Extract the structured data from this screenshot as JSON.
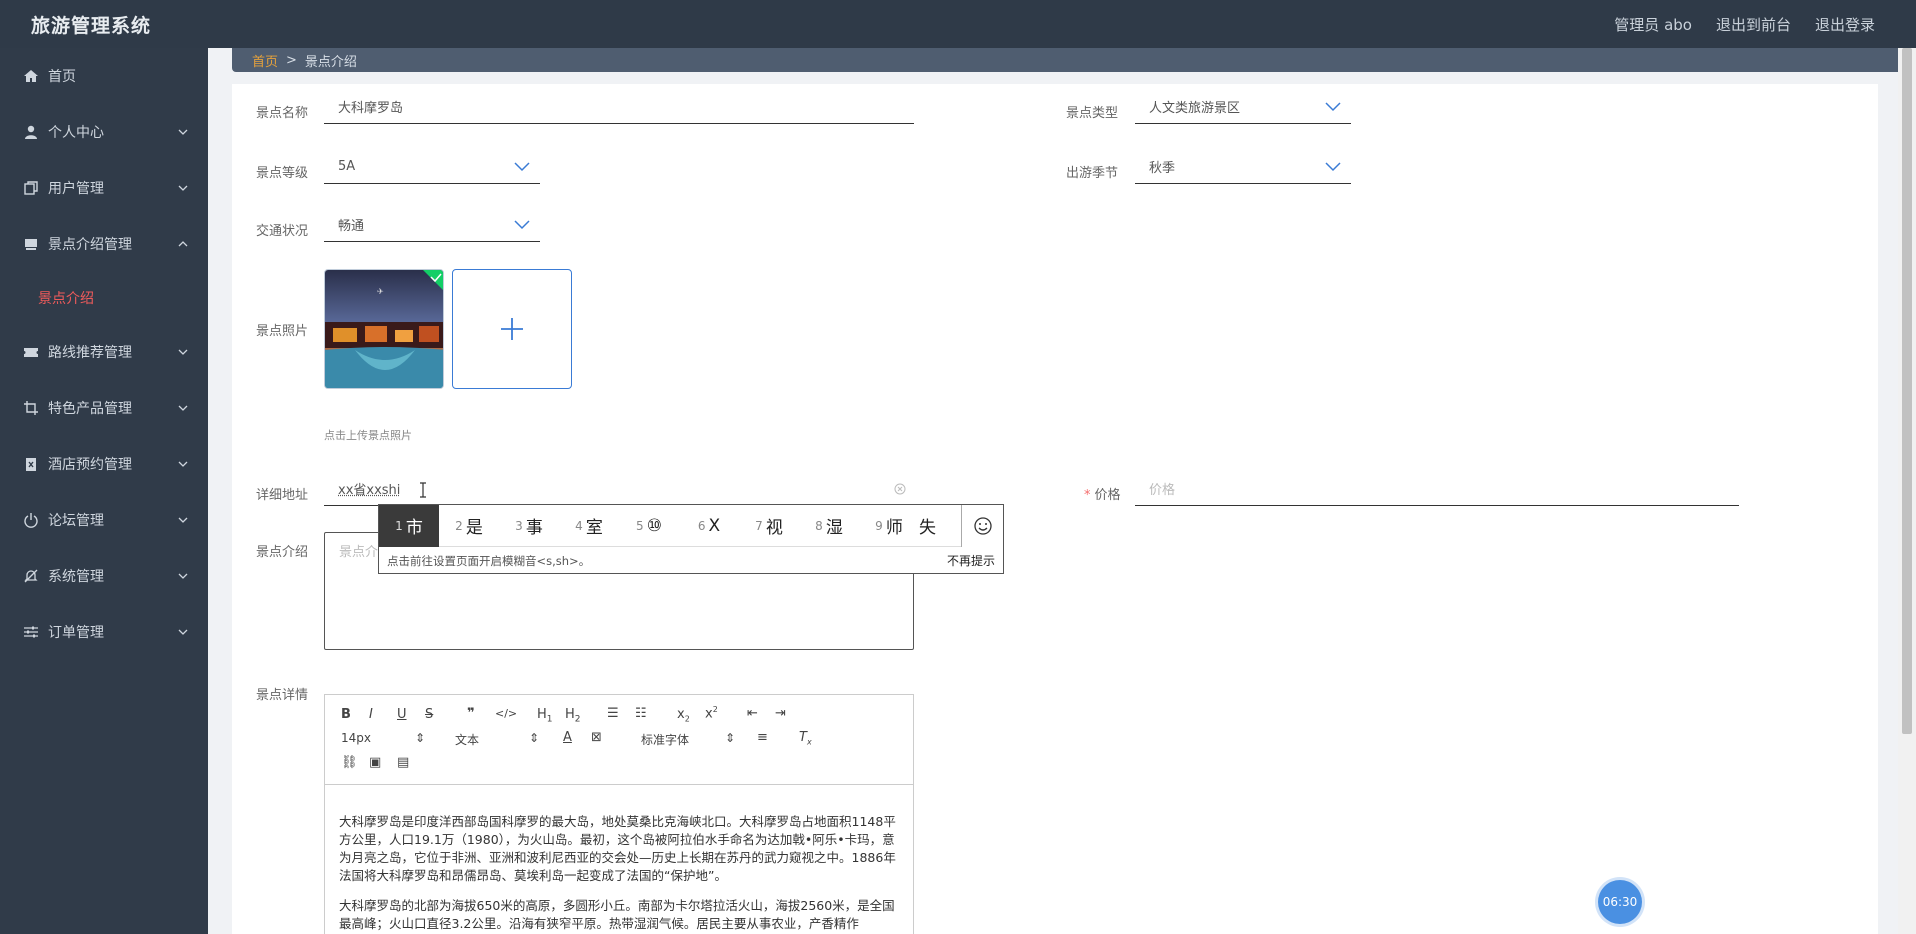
{
  "header": {
    "app_title": "旅游管理系统",
    "user_label": "管理员 abo",
    "to_front": "退出到前台",
    "logout": "退出登录"
  },
  "sidebar": {
    "items": [
      {
        "label": "首页",
        "icon": "home-icon"
      },
      {
        "label": "个人中心",
        "icon": "user-icon"
      },
      {
        "label": "用户管理",
        "icon": "copy-icon"
      },
      {
        "label": "景点介绍管理",
        "icon": "tray-icon"
      },
      {
        "label": "路线推荐管理",
        "icon": "ticket-icon"
      },
      {
        "label": "特色产品管理",
        "icon": "crop-icon"
      },
      {
        "label": "酒店预约管理",
        "icon": "delete-icon"
      },
      {
        "label": "论坛管理",
        "icon": "power-icon"
      },
      {
        "label": "系统管理",
        "icon": "bell-off-icon"
      },
      {
        "label": "订单管理",
        "icon": "sliders-icon"
      }
    ],
    "active_sub": "景点介绍"
  },
  "breadcrumb": {
    "home": "首页",
    "sep": ">",
    "current": "景点介绍"
  },
  "form": {
    "name_label": "景点名称",
    "name_value": "大科摩罗岛",
    "type_label": "景点类型",
    "type_value": "人文类旅游景区",
    "level_label": "景点等级",
    "level_value": "5A",
    "season_label": "出游季节",
    "season_value": "秋季",
    "traffic_label": "交通状况",
    "traffic_value": "畅通",
    "photo_label": "景点照片",
    "photo_hint": "点击上传景点照片",
    "address_label": "详细地址",
    "address_value": "xx省xxshi",
    "price_label": "价格",
    "price_placeholder": "价格",
    "price_required": "*",
    "intro_label": "景点介绍",
    "intro_placeholder": "景点介绍",
    "detail_label": "景点详情"
  },
  "editor": {
    "font_size": "14px",
    "block_type": "文本",
    "font_family": "标准字体",
    "paragraphs": [
      "大科摩罗岛是印度洋西部岛国科摩罗的最大岛，地处莫桑比克海峡北口。大科摩罗岛占地面积1148平方公里，人口19.1万（1980），为火山岛。最初，这个岛被阿拉伯水手命名为达加戟•阿乐•卡玛，意为月亮之岛，它位于非洲、亚洲和波利尼西亚的交会处—历史上长期在苏丹的武力窥视之中。1886年法国将大科摩罗岛和昂儒昂岛、莫埃利岛一起变成了法国的“保护地”。",
      "大科摩罗岛的北部为海拔650米的高原，多圆形小丘。南部为卡尔塔拉活火山，海拔2560米，是全国最高峰；火山口直径3.2公里。沿海有狭窄平原。热带湿润气候。居民主要从事农业，产香精作"
    ]
  },
  "ime": {
    "candidates": [
      {
        "n": "1",
        "c": "市"
      },
      {
        "n": "2",
        "c": "是"
      },
      {
        "n": "3",
        "c": "事"
      },
      {
        "n": "4",
        "c": "室"
      },
      {
        "n": "5",
        "c": "⑩"
      },
      {
        "n": "6",
        "c": "X"
      },
      {
        "n": "7",
        "c": "视"
      },
      {
        "n": "8",
        "c": "湿"
      },
      {
        "n": "9",
        "c": "师"
      },
      {
        "n": "",
        "c": "失"
      }
    ],
    "hint": "点击前往设置页面开启模糊音<s,sh>。",
    "dismiss": "不再提示"
  },
  "timer": "06:30"
}
